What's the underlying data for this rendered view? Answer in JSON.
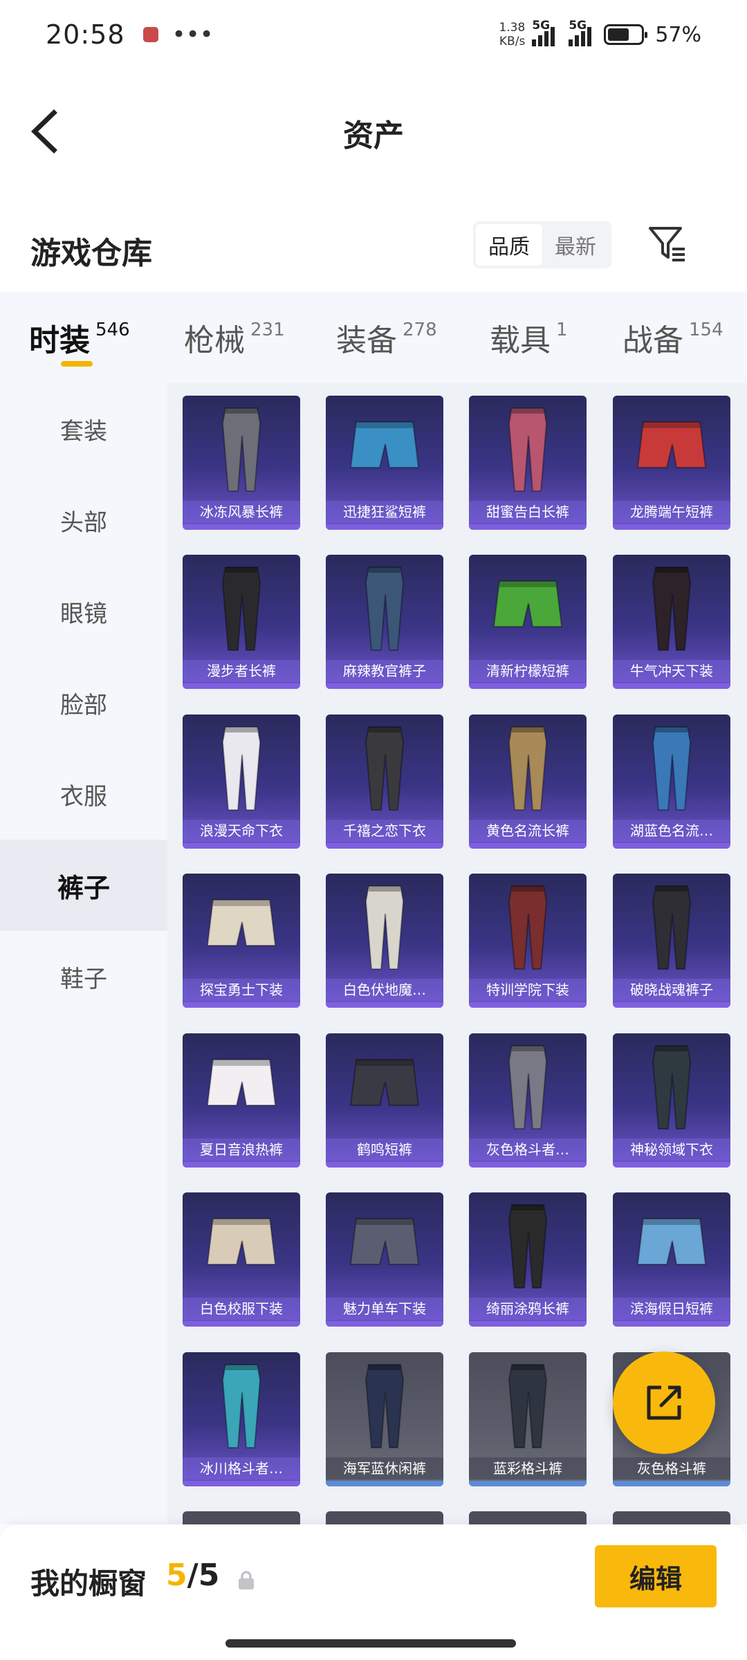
{
  "status_bar": {
    "time": "20:58",
    "speed_value": "1.38",
    "speed_unit": "KB/s",
    "sim1_label": "5G",
    "sim2_label": "5G",
    "battery_percent_text": "57%",
    "battery_level": 0.57
  },
  "header": {
    "title": "资产"
  },
  "warehouse": {
    "title": "游戏仓库",
    "sort_options": [
      {
        "label": "品质",
        "active": true
      },
      {
        "label": "最新",
        "active": false
      }
    ]
  },
  "categories": [
    {
      "label": "时装",
      "count": "546",
      "active": true
    },
    {
      "label": "枪械",
      "count": "231",
      "active": false
    },
    {
      "label": "装备",
      "count": "278",
      "active": false
    },
    {
      "label": "载具",
      "count": "1",
      "active": false
    },
    {
      "label": "战备",
      "count": "154",
      "active": false
    }
  ],
  "sidebar": {
    "items": [
      {
        "label": "套装",
        "active": false
      },
      {
        "label": "头部",
        "active": false
      },
      {
        "label": "眼镜",
        "active": false
      },
      {
        "label": "脸部",
        "active": false
      },
      {
        "label": "衣服",
        "active": false
      },
      {
        "label": "裤子",
        "active": true
      },
      {
        "label": "鞋子",
        "active": false
      }
    ]
  },
  "items": [
    {
      "name": "冰冻风暴长裤",
      "style": "purple",
      "garment": "pants",
      "color": "#6c6f78"
    },
    {
      "name": "迅捷狂鲨短裤",
      "style": "purple",
      "garment": "shorts",
      "color": "#3a8fc4"
    },
    {
      "name": "甜蜜告白长裤",
      "style": "purple",
      "garment": "pants",
      "color": "#b8566f"
    },
    {
      "name": "龙腾端午短裤",
      "style": "purple",
      "garment": "shorts",
      "color": "#c83a3a"
    },
    {
      "name": "漫步者长裤",
      "style": "purple",
      "garment": "pants",
      "color": "#2a2a2e"
    },
    {
      "name": "麻辣教官裤子",
      "style": "purple",
      "garment": "pants",
      "color": "#3c5678"
    },
    {
      "name": "清新柠檬短裤",
      "style": "purple",
      "garment": "shorts",
      "color": "#4aa83a"
    },
    {
      "name": "牛气冲天下装",
      "style": "purple",
      "garment": "pants",
      "color": "#2c2228"
    },
    {
      "name": "浪漫天命下衣",
      "style": "purple",
      "garment": "pants",
      "color": "#e8e8ee"
    },
    {
      "name": "千禧之恋下衣",
      "style": "purple",
      "garment": "pants",
      "color": "#3a3a3e"
    },
    {
      "name": "黄色名流长裤",
      "style": "purple",
      "garment": "pants",
      "color": "#a88a58"
    },
    {
      "name": "湖蓝色名流…",
      "style": "purple",
      "garment": "pants",
      "color": "#3a78b8"
    },
    {
      "name": "探宝勇士下装",
      "style": "purple",
      "garment": "shorts",
      "color": "#e0d6c4"
    },
    {
      "name": "白色伏地魔…",
      "style": "purple",
      "garment": "pants",
      "color": "#d8d6cc"
    },
    {
      "name": "特训学院下装",
      "style": "purple",
      "garment": "pants",
      "color": "#7a2e2e"
    },
    {
      "name": "破晓战魂裤子",
      "style": "purple",
      "garment": "pants",
      "color": "#2e2e34"
    },
    {
      "name": "夏日音浪热裤",
      "style": "purple",
      "garment": "shorts",
      "color": "#f2eef2"
    },
    {
      "name": "鹤鸣短裤",
      "style": "purple",
      "garment": "shorts",
      "color": "#3a3a44"
    },
    {
      "name": "灰色格斗者…",
      "style": "purple",
      "garment": "pants",
      "color": "#7a7a86"
    },
    {
      "name": "神秘领域下衣",
      "style": "purple",
      "garment": "pants",
      "color": "#2e3a40"
    },
    {
      "name": "白色校服下装",
      "style": "purple",
      "garment": "shorts",
      "color": "#d8ccb8"
    },
    {
      "name": "魅力单车下装",
      "style": "purple",
      "garment": "shorts",
      "color": "#5a5e70"
    },
    {
      "name": "绮丽涂鸦长裤",
      "style": "purple",
      "garment": "pants",
      "color": "#2a2a2a"
    },
    {
      "name": "滨海假日短裤",
      "style": "purple",
      "garment": "shorts",
      "color": "#6aa6d6"
    },
    {
      "name": "冰川格斗者…",
      "style": "purple",
      "garment": "pants",
      "color": "#3aa6b8"
    },
    {
      "name": "海军蓝休闲裤",
      "style": "gray",
      "garment": "pants",
      "color": "#2a3450"
    },
    {
      "name": "蓝彩格斗裤",
      "style": "gray",
      "garment": "pants",
      "color": "#2e3440"
    },
    {
      "name": "灰色格斗裤",
      "style": "gray",
      "garment": "pants",
      "color": "#6a6a72"
    }
  ],
  "fab": {
    "icon": "share-external-icon"
  },
  "showcase": {
    "label": "我的橱窗",
    "current": "5",
    "separator": "/",
    "total": "5",
    "edit_label": "编辑"
  },
  "colors": {
    "accent": "#f9b80c",
    "card_purple": "#3b3587",
    "card_gray": "#5c5e6b"
  }
}
